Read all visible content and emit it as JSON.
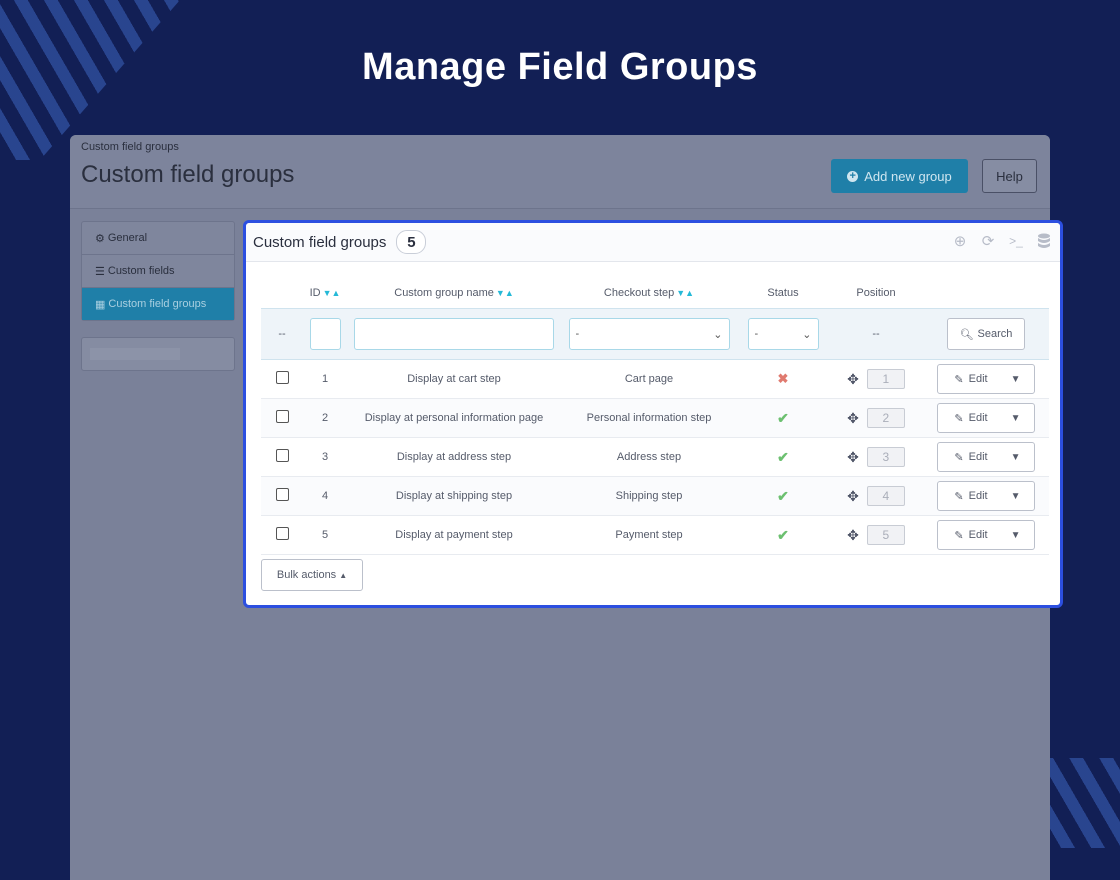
{
  "hero": {
    "title": "Manage Field Groups"
  },
  "header": {
    "breadcrumb": "Custom field groups",
    "title": "Custom field groups",
    "add_button": "Add new group",
    "help_button": "Help"
  },
  "sidebar": {
    "items": [
      {
        "label": "General",
        "icon": "gear-icon",
        "active": false
      },
      {
        "label": "Custom fields",
        "icon": "list-icon",
        "active": false
      },
      {
        "label": "Custom field groups",
        "icon": "table-icon",
        "active": true
      }
    ]
  },
  "panel": {
    "title": "Custom field groups",
    "count": "5",
    "tools": [
      "add-icon",
      "refresh-icon",
      "terminal-icon",
      "database-icon"
    ]
  },
  "table": {
    "columns": {
      "id": "ID",
      "name": "Custom group name",
      "step": "Checkout step",
      "status": "Status",
      "position": "Position"
    },
    "filter": {
      "empty_marker": "--",
      "step_select": "-",
      "status_select": "-",
      "position_marker": "--",
      "search_button": "Search"
    },
    "rows": [
      {
        "id": "1",
        "name": "Display at cart step",
        "step": "Cart page",
        "status": "disabled",
        "position": "1",
        "edit": "Edit"
      },
      {
        "id": "2",
        "name": "Display at personal information page",
        "step": "Personal information step",
        "status": "enabled",
        "position": "2",
        "edit": "Edit"
      },
      {
        "id": "3",
        "name": "Display at address step",
        "step": "Address step",
        "status": "enabled",
        "position": "3",
        "edit": "Edit"
      },
      {
        "id": "4",
        "name": "Display at shipping step",
        "step": "Shipping step",
        "status": "enabled",
        "position": "4",
        "edit": "Edit"
      },
      {
        "id": "5",
        "name": "Display at payment step",
        "step": "Payment step",
        "status": "enabled",
        "position": "5",
        "edit": "Edit"
      }
    ]
  },
  "footer": {
    "bulk_actions": "Bulk actions"
  },
  "colors": {
    "accent": "#25b9d7",
    "frame": "#2c4fe0",
    "background": "#121f55"
  }
}
